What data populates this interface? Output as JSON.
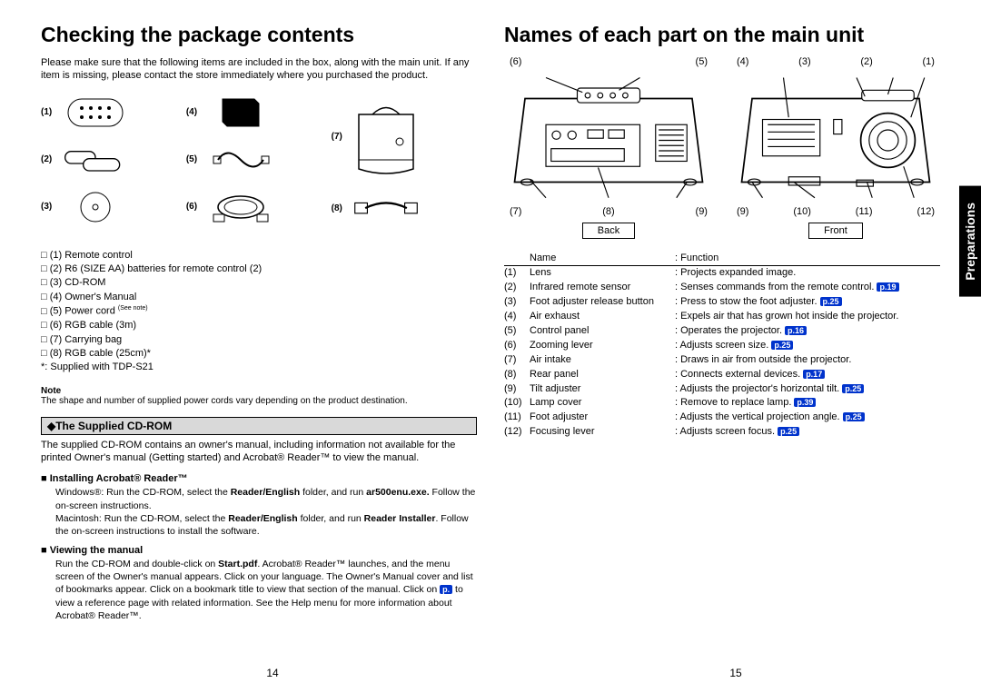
{
  "left": {
    "title": "Checking the package contents",
    "intro": "Please make sure that the following items are included in the box, along with the main unit. If any item is missing, please contact the store immediately where you purchased the product.",
    "items_nums": {
      "n1": "(1)",
      "n2": "(2)",
      "n3": "(3)",
      "n4": "(4)",
      "n5": "(5)",
      "n6": "(6)",
      "n7": "(7)",
      "n8": "(8)"
    },
    "checklist": {
      "c1": "(1)  Remote control",
      "c2": "(2)  R6 (SIZE AA) batteries for remote control (2)",
      "c3": "(3)  CD-ROM",
      "c4": "(4)  Owner's Manual",
      "c5": "(5)  Power cord ",
      "c5_note": "(See note)",
      "c6": "(6)  RGB cable (3m)",
      "c7": "(7)  Carrying bag",
      "c8": "(8)  RGB cable (25cm)*",
      "star": "*: Supplied with TDP-S21"
    },
    "note_head": "Note",
    "note_body": "The shape and number of supplied power cords vary depending on the product destination.",
    "cd_title": "◆The Supplied CD-ROM",
    "cd_body": "The supplied CD-ROM contains an owner's manual, including information not available for the printed Owner's manual (Getting started) and Acrobat® Reader™ to view the manual.",
    "inst_head": "Installing Acrobat® Reader™",
    "inst_body1a": "Windows®: Run the CD-ROM, select the ",
    "inst_body1b": "Reader/English",
    "inst_body1c": " folder, and run ",
    "inst_body1d": "ar500enu.exe.",
    "inst_body1e": " Follow the on-screen instructions.",
    "inst_body2a": "Macintosh: Run the CD-ROM, select the ",
    "inst_body2b": "Reader/English",
    "inst_body2c": " folder, and run ",
    "inst_body2d": "Reader Installer",
    "inst_body2e": ". Follow the on-screen instructions to install the software.",
    "view_head": "Viewing the manual",
    "view_body1": "Run the CD-ROM and double-click on ",
    "view_body2": "Start.pdf",
    "view_body3": ". Acrobat® Reader™ launches, and the menu screen of the Owner's manual appears. Click on your language. The Owner's Manual cover and list of bookmarks appear. Click on a bookmark title to view that section of the manual. Click on ",
    "view_ref": "p.",
    "view_body4": " to view a reference page with related information. See the Help menu for more information about Acrobat® Reader™.",
    "page_num": "14"
  },
  "right": {
    "title": "Names of each part on the main unit",
    "back_label": "Back",
    "front_label": "Front",
    "back_top": {
      "a": "(6)",
      "b": "(5)"
    },
    "back_bot": {
      "a": "(7)",
      "b": "(8)",
      "c": "(9)"
    },
    "front_top": {
      "a": "(4)",
      "b": "(3)",
      "c": "(2)",
      "d": "(1)"
    },
    "front_bot": {
      "a": "(9)",
      "b": "(10)",
      "c": "(11)",
      "d": "(12)"
    },
    "table_head": {
      "name": "Name",
      "func": ": Function"
    },
    "rows": [
      {
        "n": "(1)",
        "name": "Lens",
        "func": ": Projects expanded image."
      },
      {
        "n": "(2)",
        "name": "Infrared remote sensor",
        "func": ": Senses commands from the remote control.",
        "ref": "p.19"
      },
      {
        "n": "(3)",
        "name": "Foot adjuster release button",
        "func": ": Press to stow the foot adjuster.",
        "ref": "p.25"
      },
      {
        "n": "(4)",
        "name": "Air exhaust",
        "func": ": Expels air that has grown hot inside the projector."
      },
      {
        "n": "(5)",
        "name": "Control panel",
        "func": ": Operates the projector.",
        "ref": "p.16"
      },
      {
        "n": "(6)",
        "name": "Zooming lever",
        "func": ": Adjusts screen size.",
        "ref": "p.25"
      },
      {
        "n": "(7)",
        "name": "Air intake",
        "func": ": Draws in air from outside the projector."
      },
      {
        "n": "(8)",
        "name": "Rear panel",
        "func": ": Connects external devices.",
        "ref": "p.17"
      },
      {
        "n": "(9)",
        "name": "Tilt adjuster",
        "func": ": Adjusts the projector's horizontal tilt.",
        "ref": "p.25"
      },
      {
        "n": "(10)",
        "name": "Lamp cover",
        "func": ": Remove to replace lamp.",
        "ref": "p.39"
      },
      {
        "n": "(11)",
        "name": "Foot adjuster",
        "func": ": Adjusts the vertical projection angle.",
        "ref": "p.25"
      },
      {
        "n": "(12)",
        "name": "Focusing lever",
        "func": ": Adjusts screen focus.",
        "ref": "p.25"
      }
    ],
    "side_tab": "Preparations",
    "page_num": "15"
  }
}
